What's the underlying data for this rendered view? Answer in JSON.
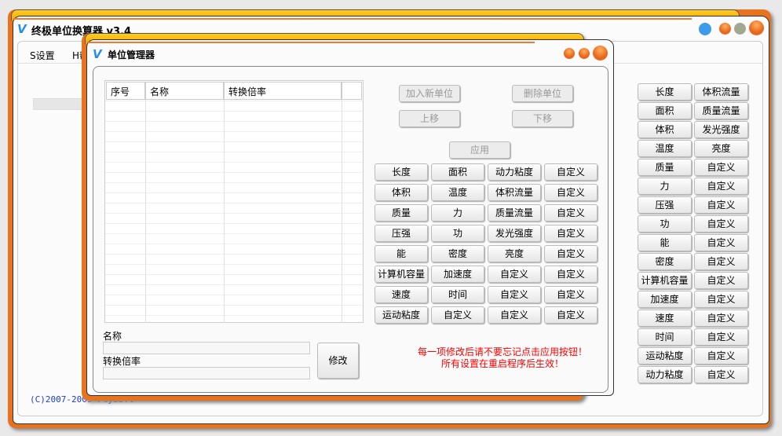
{
  "main_window": {
    "title": "终极单位换算器 v3.4",
    "menu": [
      {
        "label": "S设置"
      },
      {
        "label": "H帮"
      }
    ],
    "copyright": "(C)2007-2009 FlySoft",
    "categories": [
      [
        "长度",
        "体积流量"
      ],
      [
        "面积",
        "质量流量"
      ],
      [
        "体积",
        "发光强度"
      ],
      [
        "温度",
        "亮度"
      ],
      [
        "质量",
        "自定义"
      ],
      [
        "力",
        "自定义"
      ],
      [
        "压强",
        "自定义"
      ],
      [
        "功",
        "自定义"
      ],
      [
        "能",
        "自定义"
      ],
      [
        "密度",
        "自定义"
      ],
      [
        "计算机容量",
        "自定义"
      ],
      [
        "加速度",
        "自定义"
      ],
      [
        "速度",
        "自定义"
      ],
      [
        "时间",
        "自定义"
      ],
      [
        "运动粘度",
        "自定义"
      ],
      [
        "动力粘度",
        "自定义"
      ]
    ]
  },
  "dialog": {
    "title": "单位管理器",
    "table": {
      "columns": [
        "序号",
        "名称",
        "转换倍率"
      ],
      "rows": []
    },
    "buttons": {
      "add": "加入新单位",
      "delete": "删除单位",
      "up": "上移",
      "down": "下移",
      "apply": "应用",
      "modify": "修改"
    },
    "fields": {
      "name_label": "名称",
      "name_value": "",
      "rate_label": "转换倍率",
      "rate_value": ""
    },
    "categories": [
      [
        "长度",
        "面积",
        "动力粘度",
        "自定义"
      ],
      [
        "体积",
        "温度",
        "体积流量",
        "自定义"
      ],
      [
        "质量",
        "力",
        "质量流量",
        "自定义"
      ],
      [
        "压强",
        "功",
        "发光强度",
        "自定义"
      ],
      [
        "能",
        "密度",
        "亮度",
        "自定义"
      ],
      [
        "计算机容量",
        "加速度",
        "自定义",
        "自定义"
      ],
      [
        "速度",
        "时间",
        "自定义",
        "自定义"
      ],
      [
        "运动粘度",
        "自定义",
        "自定义",
        "自定义"
      ]
    ],
    "notice": [
      "每一项修改后请不要忘记点击应用按钮！",
      "所有设置在重启程序后生效！"
    ],
    "notice_color": "#ff0000"
  }
}
